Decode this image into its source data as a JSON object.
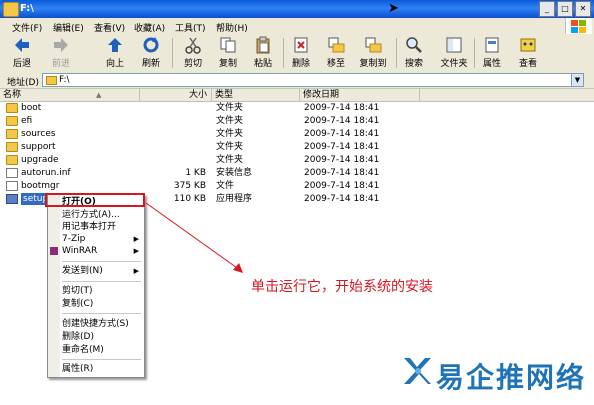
{
  "window": {
    "title": "F:\\"
  },
  "menu": [
    "文件(F)",
    "编辑(E)",
    "查看(V)",
    "收藏(A)",
    "工具(T)",
    "帮助(H)"
  ],
  "toolbar": {
    "back": "后退",
    "forward": "前进",
    "up": "向上",
    "refresh": "刷新",
    "cut": "剪切",
    "copy": "复制",
    "paste": "粘贴",
    "delete": "删除",
    "moveto": "移至",
    "copyto": "复制到",
    "search": "搜索",
    "folders": "文件夹",
    "properties": "属性",
    "view": "查看"
  },
  "address": {
    "label": "地址(D)",
    "value": "F:\\"
  },
  "columns": {
    "name": "名称",
    "size": "大小",
    "type": "类型",
    "modified": "修改日期"
  },
  "files": [
    {
      "name": "boot",
      "size": "",
      "type": "文件夹",
      "date": "2009-7-14 18:41"
    },
    {
      "name": "efi",
      "size": "",
      "type": "文件夹",
      "date": "2009-7-14 18:41"
    },
    {
      "name": "sources",
      "size": "",
      "type": "文件夹",
      "date": "2009-7-14 18:41"
    },
    {
      "name": "support",
      "size": "",
      "type": "文件夹",
      "date": "2009-7-14 18:41"
    },
    {
      "name": "upgrade",
      "size": "",
      "type": "文件夹",
      "date": "2009-7-14 18:41"
    },
    {
      "name": "autorun.inf",
      "size": "1 KB",
      "type": "安装信息",
      "date": "2009-7-14 18:41"
    },
    {
      "name": "bootmgr",
      "size": "375 KB",
      "type": "文件",
      "date": "2009-7-14 18:41"
    },
    {
      "name": "setup.e",
      "size": "110 KB",
      "type": "应用程序",
      "date": "2009-7-14 18:41"
    }
  ],
  "context_menu": {
    "open": "打开(O)",
    "runas": "运行方式(A)...",
    "notepad": "用记事本打开",
    "zip": "7-Zip",
    "winrar": "WinRAR",
    "sendto": "发送到(N)",
    "cut": "剪切(T)",
    "copy": "复制(C)",
    "shortcut": "创建快捷方式(S)",
    "delete": "删除(D)",
    "rename": "重命名(M)",
    "properties": "属性(R)"
  },
  "annotation": "单击运行它，开始系统的安装",
  "watermark": "易企推网络",
  "colors": {
    "highlight": "#d7171f",
    "selection": "#316ac5",
    "watermark": "#1f73b7"
  }
}
